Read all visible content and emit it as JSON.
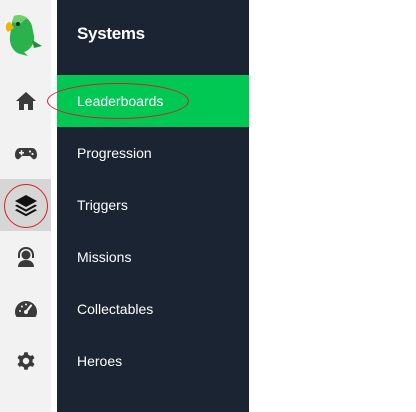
{
  "sidebar": {
    "logo_icon": "parrot-logo",
    "items": [
      {
        "icon": "home-icon",
        "label": "Home"
      },
      {
        "icon": "gamepad-icon",
        "label": "Games"
      },
      {
        "icon": "layers-icon",
        "label": "Systems",
        "active": true
      },
      {
        "icon": "support-agent-icon",
        "label": "Support"
      },
      {
        "icon": "speedometer-icon",
        "label": "Dashboard"
      },
      {
        "icon": "gear-icon",
        "label": "Settings"
      }
    ]
  },
  "panel": {
    "title": "Systems",
    "items": [
      {
        "label": "Leaderboards",
        "active": true
      },
      {
        "label": "Progression"
      },
      {
        "label": "Triggers"
      },
      {
        "label": "Missions"
      },
      {
        "label": "Collectables"
      },
      {
        "label": "Heroes"
      }
    ]
  },
  "colors": {
    "panel_bg": "#1b2432",
    "accent": "#00c853",
    "rail_bg": "#f2f2f2",
    "rail_active": "#d6d6d6",
    "annotation": "#d0202a"
  }
}
